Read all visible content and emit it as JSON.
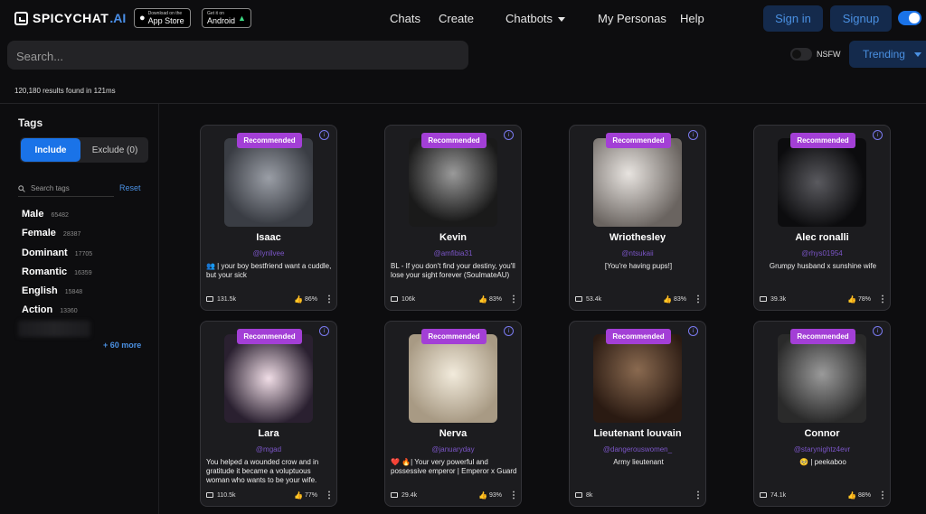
{
  "header": {
    "logo_text": "SPICYCHAT",
    "logo_suffix": ".AI",
    "app_store_small": "Download on the",
    "app_store_big": "App Store",
    "android_small": "Get it on",
    "android_big": "Android",
    "nav": [
      "Chats",
      "Create",
      "Chatbots",
      "My Personas",
      "Help"
    ],
    "signin_label": "Sign in",
    "signup_label": "Signup"
  },
  "search": {
    "placeholder": "Search..."
  },
  "filters": {
    "nsfw_label": "NSFW",
    "sort_label": "Trending"
  },
  "results_text": "120,180 results found in 121ms",
  "sidebar": {
    "title": "Tags",
    "include_label": "Include",
    "exclude_label": "Exclude (0)",
    "tag_search_placeholder": "Search tags",
    "reset_label": "Reset",
    "tags": [
      {
        "name": "Male",
        "count": "65482"
      },
      {
        "name": "Female",
        "count": "28387"
      },
      {
        "name": "Dominant",
        "count": "17705"
      },
      {
        "name": "Romantic",
        "count": "16359"
      },
      {
        "name": "English",
        "count": "15848"
      },
      {
        "name": "Action",
        "count": "13360"
      }
    ],
    "more_label": "+ 60 more"
  },
  "cards": [
    {
      "badge": "Recommended",
      "name": "Isaac",
      "handle": "@lynllvee",
      "desc": "👥 | your boy bestfriend want a cuddle, but your sick",
      "messages": "131.5k",
      "rating": "86%",
      "img": "#5a5d64"
    },
    {
      "badge": "Recommended",
      "name": "Kevin",
      "handle": "@amfibia31",
      "desc": "BL - If you don't find your destiny, you'll lose your sight forever (SoulmateAU)",
      "messages": "106k",
      "rating": "83%",
      "img": "#6a6a6a"
    },
    {
      "badge": "Recommended",
      "name": "Wriothesley",
      "handle": "@ntsukaii",
      "desc": "[You're having pups!]",
      "messages": "53.4k",
      "rating": "83%",
      "img": "#b9b4b0"
    },
    {
      "badge": "Recommended",
      "name": "Alec ronalli",
      "handle": "@rhys01954",
      "desc": "Grumpy husband x sunshine wife",
      "messages": "39.3k",
      "rating": "78%",
      "img": "#2a2a2d"
    },
    {
      "badge": "Recommended",
      "name": "Lara",
      "handle": "@mgad",
      "desc": "You helped a wounded crow and in gratitude it became a voluptuous woman who wants to be your wife.",
      "messages": "110.5k",
      "rating": "77%",
      "img": "#d9c9d3"
    },
    {
      "badge": "Recommended",
      "name": "Nerva",
      "handle": "@januaryday",
      "desc": "❤️ 🔥| Your very powerful and possessive emperor | Emperor x Guard",
      "messages": "29.4k",
      "rating": "93%",
      "img": "#e6dcc8"
    },
    {
      "badge": "Recommended",
      "name": "Lieutenant louvain",
      "handle": "@dangerouswomen_",
      "desc": "Army lieutenant",
      "messages": "8k",
      "rating": "",
      "img": "#5a3a2a"
    },
    {
      "badge": "Recommended",
      "name": "Connor",
      "handle": "@starynightz4evr",
      "desc": "🥺 | peekaboo",
      "messages": "74.1k",
      "rating": "88%",
      "img": "#5e5e5e"
    }
  ]
}
